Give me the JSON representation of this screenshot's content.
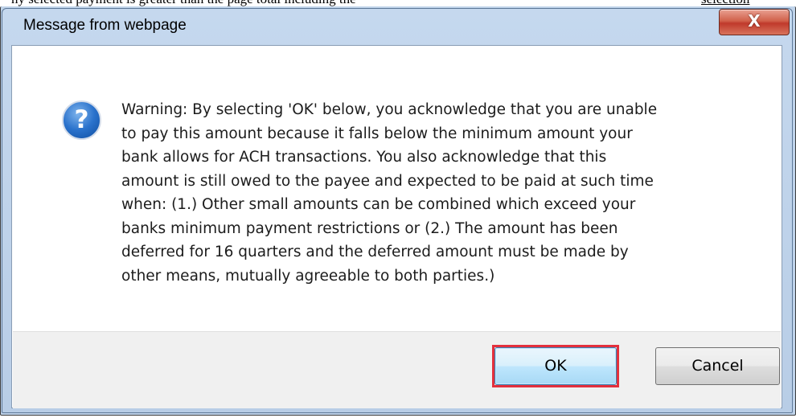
{
  "background": {
    "text": "ny selected payment is greater than the page total including the",
    "link": "selection"
  },
  "dialog": {
    "title": "Message from webpage",
    "close_glyph": "X",
    "icon": "question-icon",
    "icon_glyph": "?",
    "message_lines": [
      "Warning: By selecting 'OK' below, you acknowledge that you are unable",
      "to pay this amount because it falls below the minimum amount your",
      "bank allows for ACH transactions. You also acknowledge that this",
      "amount is still owed to the payee and expected to be paid at such time",
      "when: (1.) Other small amounts can be  combined which exceed your",
      "banks minimum payment restrictions or (2.) The amount has been",
      "deferred for 16 quarters and the deferred amount must be made by",
      "other means, mutually agreeable to both parties.)"
    ],
    "buttons": {
      "ok": "OK",
      "cancel": "Cancel"
    }
  },
  "colors": {
    "highlight": "#e3303d",
    "close_button": "#c0392b",
    "icon_blue": "#2a72cc"
  }
}
